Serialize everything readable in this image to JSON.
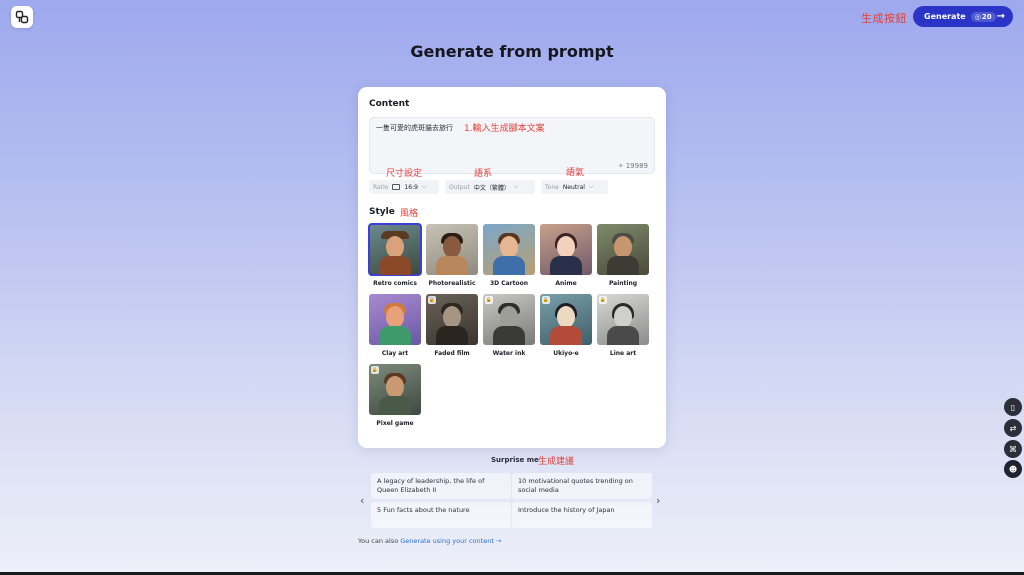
{
  "header": {
    "annotation": "生成按鈕",
    "generate_label": "Generate",
    "credits": "20",
    "arrow": "→"
  },
  "page_title": "Generate from prompt",
  "content": {
    "label": "Content",
    "prompt_value": "一隻可愛的虎斑貓去旅行",
    "prompt_annotation": "1.輸入生成腳本文案",
    "char_count": "19989",
    "annotations": {
      "ratio": "尺寸設定",
      "output": "語系",
      "tone": "語氣"
    },
    "options": {
      "ratio": {
        "key": "Ratio",
        "value": "16:9"
      },
      "output": {
        "key": "Output",
        "value": "中文（繁體）"
      },
      "tone": {
        "key": "Tone",
        "value": "Neutral"
      }
    }
  },
  "style": {
    "label": "Style",
    "annotation": "風格",
    "items": [
      {
        "name": "Retro comics",
        "selected": true,
        "locked": false
      },
      {
        "name": "Photorealistic",
        "selected": false,
        "locked": false
      },
      {
        "name": "3D Cartoon",
        "selected": false,
        "locked": false
      },
      {
        "name": "Anime",
        "selected": false,
        "locked": false
      },
      {
        "name": "Painting",
        "selected": false,
        "locked": false
      },
      {
        "name": "Clay art",
        "selected": false,
        "locked": false
      },
      {
        "name": "Faded film",
        "selected": false,
        "locked": true
      },
      {
        "name": "Water ink",
        "selected": false,
        "locked": true
      },
      {
        "name": "Ukiyo-e",
        "selected": false,
        "locked": true
      },
      {
        "name": "Line art",
        "selected": false,
        "locked": true
      },
      {
        "name": "Pixel game",
        "selected": false,
        "locked": true
      }
    ]
  },
  "surprise": {
    "label": "Surprise me",
    "annotation": "生成建議",
    "suggestions": [
      "A legacy of leadership, the life of Queen Elizabeth II",
      "10 motivational quotes trending on social media",
      "5 Fun facts about the nature",
      "Introduce the history of Japan"
    ]
  },
  "footer": {
    "prefix": "You can also",
    "link": "Generate using your content →"
  },
  "colors": {
    "accent": "#2a35c8",
    "annotation": "#e0413a",
    "link": "#2f6ed8"
  }
}
